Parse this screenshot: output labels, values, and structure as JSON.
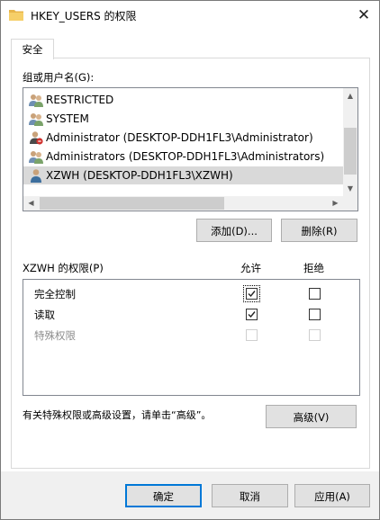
{
  "window": {
    "title": "HKEY_USERS 的权限",
    "close_glyph": "✕"
  },
  "tab": {
    "label": "安全"
  },
  "groups": {
    "label": "组或用户名(G):",
    "items": [
      {
        "text": "RESTRICTED",
        "icon": "users-group-icon",
        "selected": false
      },
      {
        "text": "SYSTEM",
        "icon": "users-group-icon",
        "selected": false
      },
      {
        "text": "Administrator (DESKTOP-DDH1FL3\\Administrator)",
        "icon": "admin-user-icon",
        "selected": false
      },
      {
        "text": "Administrators (DESKTOP-DDH1FL3\\Administrators)",
        "icon": "users-group-icon",
        "selected": false
      },
      {
        "text": "XZWH (DESKTOP-DDH1FL3\\XZWH)",
        "icon": "single-user-icon",
        "selected": true
      }
    ],
    "add_label": "添加(D)...",
    "remove_label": "删除(R)"
  },
  "permissions": {
    "label": "XZWH 的权限(P)",
    "allow_header": "允许",
    "deny_header": "拒绝",
    "rows": [
      {
        "name": "完全控制",
        "allow": true,
        "deny": false,
        "enabled": true
      },
      {
        "name": "读取",
        "allow": true,
        "deny": false,
        "enabled": true
      },
      {
        "name": "特殊权限",
        "allow": false,
        "deny": false,
        "enabled": false
      }
    ]
  },
  "advanced": {
    "hint": "有关特殊权限或高级设置，请单击“高级”。",
    "button_label": "高级(V)"
  },
  "footer": {
    "ok_label": "确定",
    "cancel_label": "取消",
    "apply_label": "应用(A)"
  },
  "colors": {
    "selection": "#d9d9d9",
    "focus_border": "#0078d7",
    "button_face": "#e1e1e1"
  }
}
